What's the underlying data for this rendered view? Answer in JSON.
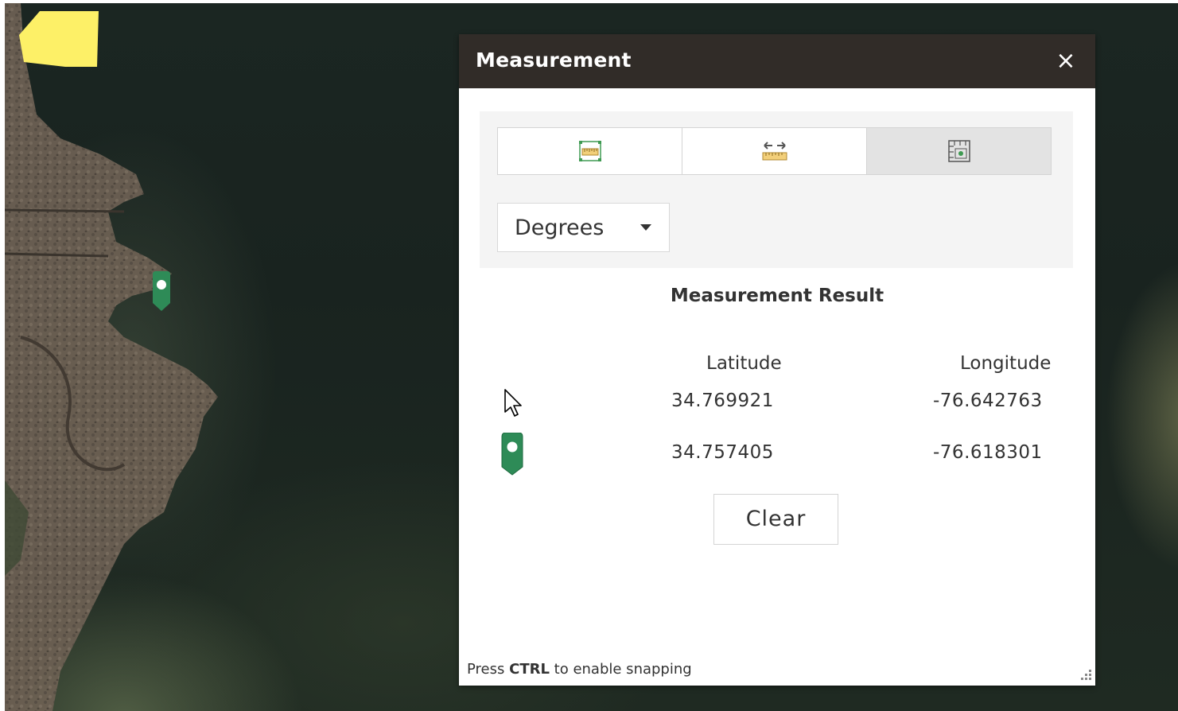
{
  "widget": {
    "title": "Measurement",
    "close_icon": "×",
    "tools": [
      {
        "name": "measure-area-icon"
      },
      {
        "name": "measure-distance-icon"
      },
      {
        "name": "measure-location-icon",
        "active": true
      }
    ],
    "unit_select": {
      "value": "Degrees",
      "icon": "caret-down-icon"
    },
    "result": {
      "title": "Measurement Result",
      "columns": [
        "Latitude",
        "Longitude"
      ],
      "rows": [
        {
          "icon": "mouse-cursor-icon",
          "latitude": "34.769921",
          "longitude": "-76.642763"
        },
        {
          "icon": "map-pin-icon",
          "latitude": "34.757405",
          "longitude": "-76.618301"
        }
      ]
    },
    "clear_label": "Clear",
    "snap_hint": {
      "pre": "Press ",
      "key": "CTRL",
      "post": " to enable snapping"
    }
  },
  "colors": {
    "titlebar": "#312c28",
    "marker": "#2e8b57",
    "yellow_area": "#fdf067"
  }
}
